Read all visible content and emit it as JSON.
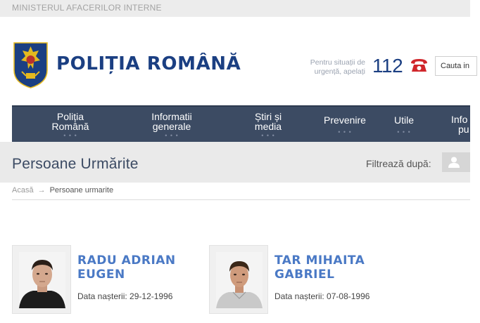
{
  "ministry": {
    "label": "MINISTERUL AFACERILOR INTERNE"
  },
  "header": {
    "brand": "POLIȚIA ROMÂNĂ",
    "emergency_line1": "Pentru situații de",
    "emergency_line2": "urgență, apelați",
    "emergency_number": "112",
    "search_placeholder": "Cauta in"
  },
  "nav": {
    "items": [
      {
        "line1": "Poliția",
        "line2": "Română"
      },
      {
        "line1": "Informatii",
        "line2": "generale"
      },
      {
        "line1": "Știri și",
        "line2": "media"
      },
      {
        "line1": "Prevenire",
        "line2": ""
      },
      {
        "line1": "Utile",
        "line2": ""
      },
      {
        "line1": "Info",
        "line2": "pu"
      }
    ]
  },
  "page": {
    "title": "Persoane Urmărite",
    "filter_label": "Filtrează după:"
  },
  "breadcrumb": {
    "home": "Acasă",
    "arrow": "→",
    "current": "Persoane urmarite"
  },
  "persons": [
    {
      "name_line1": "RADU ADRIAN",
      "name_line2": "EUGEN",
      "dob_label": "Data nașterii:",
      "dob": "29-12-1996"
    },
    {
      "name_line1": "TAR MIHAITA",
      "name_line2": "GABRIEL",
      "dob_label": "Data nașterii:",
      "dob": "07-08-1996"
    }
  ],
  "colors": {
    "brand_blue": "#1b3f82",
    "nav_bg": "#3c4b63",
    "name_blue": "#4a79c5",
    "phone_red": "#d0262b"
  },
  "icons": {
    "crest": "romanian-police-crest-icon",
    "phone": "telephone-icon",
    "filter": "person-icon"
  }
}
